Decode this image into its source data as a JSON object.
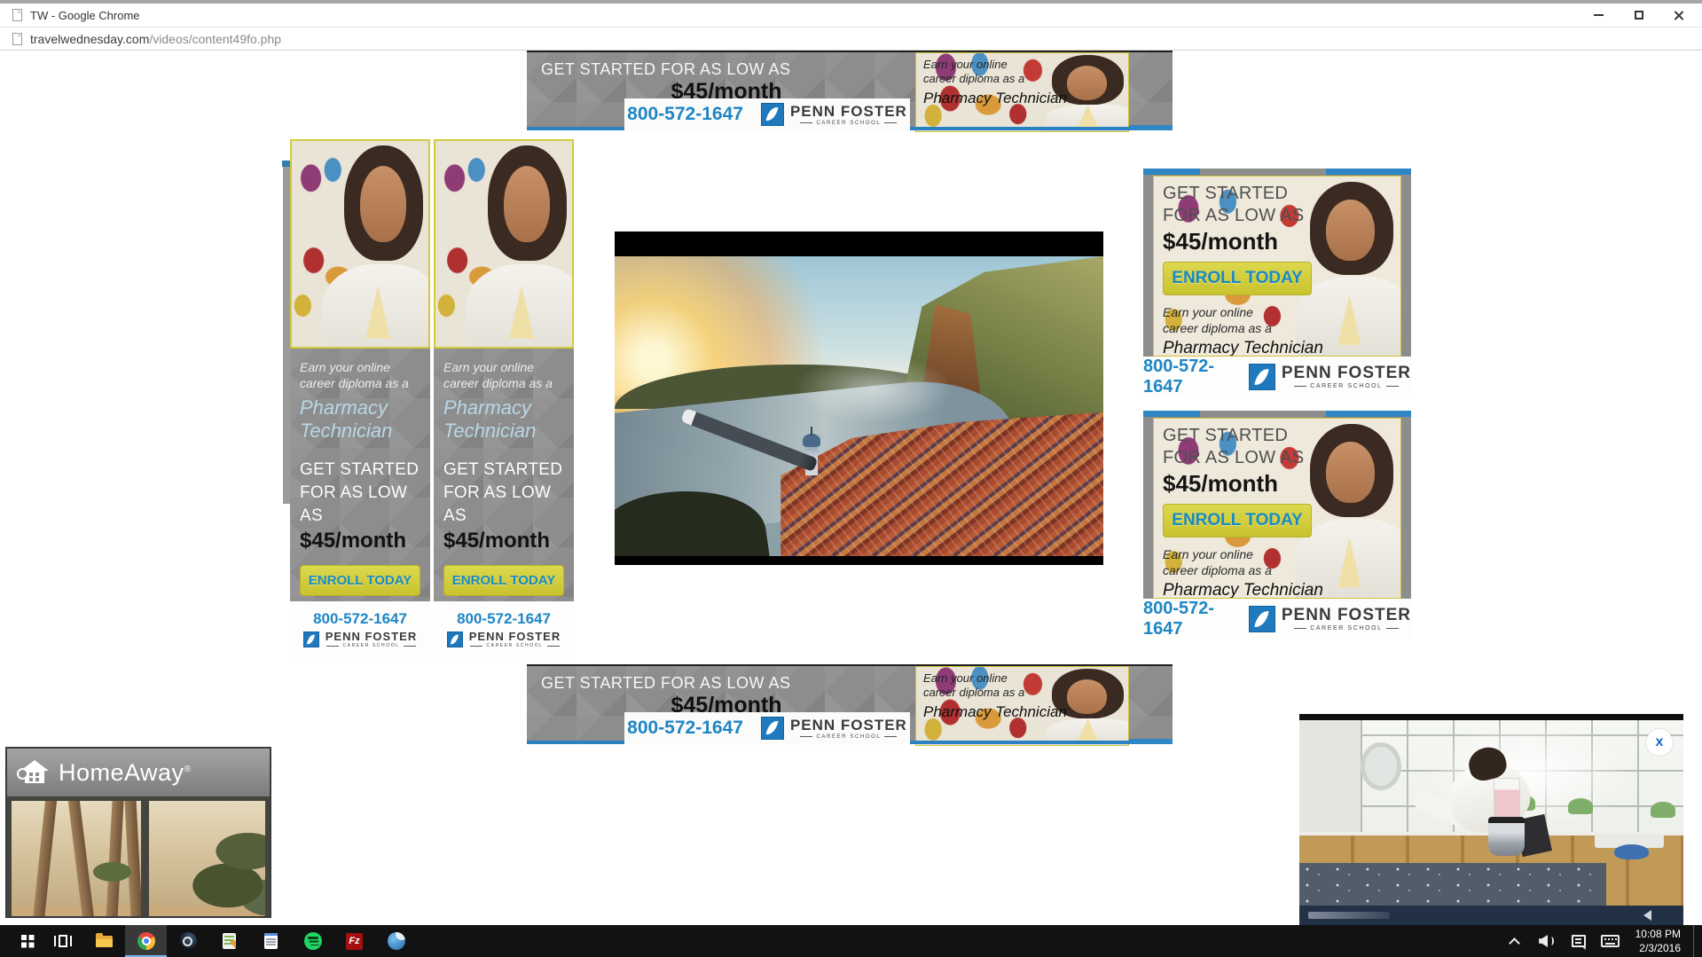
{
  "window": {
    "title": "TW - Google Chrome",
    "url_domain": "travelwednesday.com",
    "url_path": "/videos/content49fo.php"
  },
  "ad": {
    "headline_inline": "GET STARTED FOR AS LOW AS",
    "headline_line1": "GET STARTED",
    "headline_line2": "FOR AS LOW AS",
    "price": "$45/month",
    "cta": "ENROLL TODAY",
    "tagline_line1": "Earn your online",
    "tagline_line2": "career diploma as a",
    "program": "Pharmacy Technician",
    "program_word1": "Pharmacy",
    "program_word2": "Technician",
    "phone": "800-572-1647",
    "brand": "PENN FOSTER",
    "brand_sub": "CAREER SCHOOL"
  },
  "homeaway": {
    "brand": "HomeAway",
    "mark": "®"
  },
  "overlay": {
    "close_label": "x"
  },
  "taskbar": {
    "time": "10:08 PM",
    "date": "2/3/2016",
    "filezilla_label": "Fz",
    "icons": [
      "start",
      "task-view",
      "file-explorer",
      "chrome",
      "steam",
      "notepad-plus",
      "notepad",
      "spotify",
      "filezilla",
      "thunderbird"
    ],
    "tray_icons": [
      "hidden-icons-chevron",
      "volume",
      "action-center",
      "touch-keyboard"
    ]
  },
  "colors": {
    "penn_blue": "#1e86c6",
    "cta_yellow": "#d8d23f",
    "cta_text": "#1a8ac2",
    "ad_gray": "#8d8d8d",
    "program_blue": "#b9d7e6",
    "taskbar_bg": "#121212",
    "active_underline": "#76b9ed"
  }
}
